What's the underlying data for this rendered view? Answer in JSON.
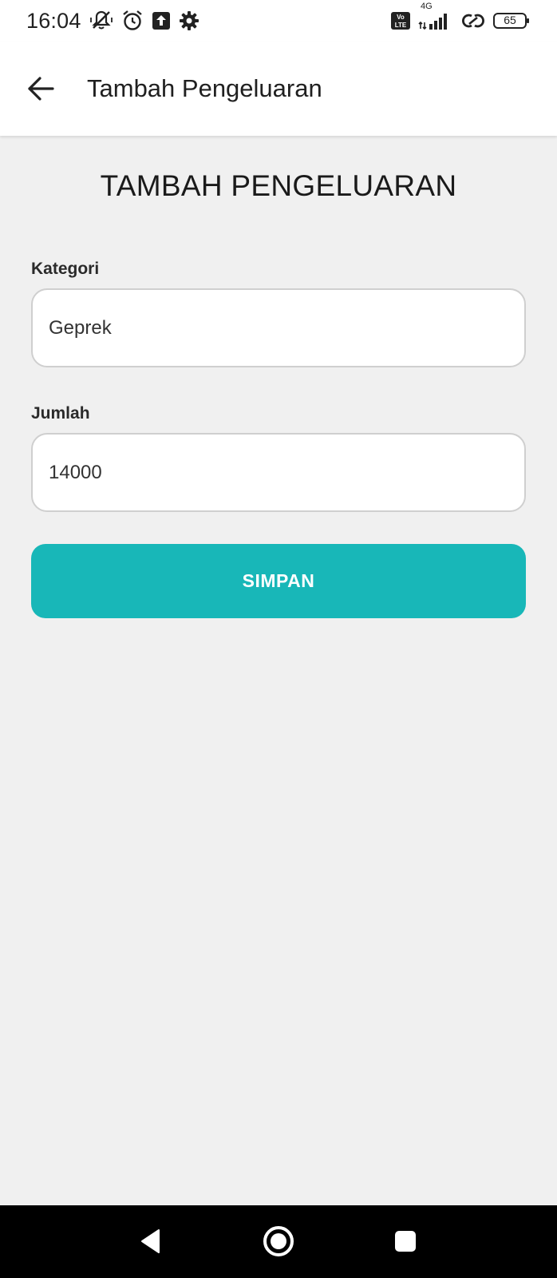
{
  "status_bar": {
    "time": "16:04",
    "battery": "65",
    "network": "4G",
    "icons": [
      "vibrate-off-icon",
      "alarm-icon",
      "upload-icon",
      "settings-gear-icon",
      "volte-icon",
      "signal-icon",
      "link-icon",
      "battery-icon"
    ]
  },
  "app_bar": {
    "title": "Tambah Pengeluaran",
    "back_icon": "arrow-left-icon"
  },
  "form": {
    "heading": "TAMBAH PENGELUARAN",
    "kategori_label": "Kategori",
    "kategori_value": "Geprek",
    "jumlah_label": "Jumlah",
    "jumlah_value": "14000",
    "save_label": "SIMPAN"
  },
  "nav_bar": {
    "icons": [
      "back-triangle-icon",
      "home-circle-icon",
      "recents-square-icon"
    ]
  },
  "colors": {
    "accent": "#18b7b8",
    "background": "#f0f0f0",
    "surface": "#ffffff"
  }
}
